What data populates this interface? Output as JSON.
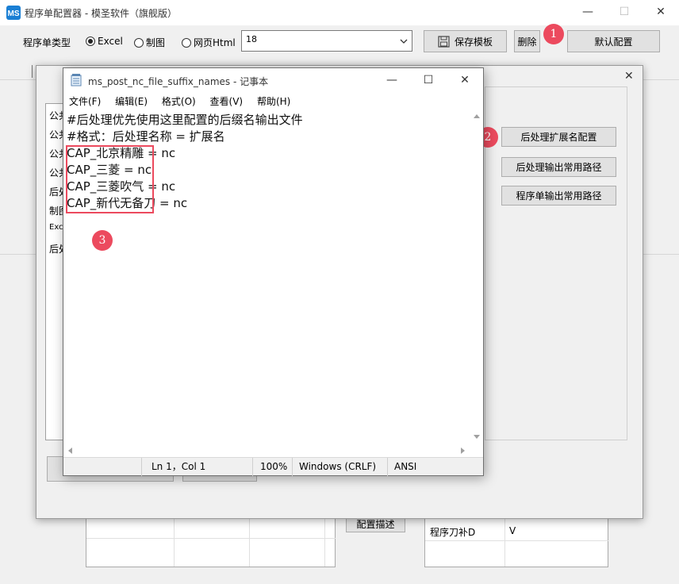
{
  "main_window": {
    "title": "程序单配置器 - 模圣软件（旗舰版）",
    "type_label": "程序单类型",
    "radio_excel": "Excel",
    "radio_drawing": "制图",
    "radio_html": "网页Html",
    "template_value": "18",
    "save_template": "保存模板",
    "delete": "删除",
    "default_config": "默认配置",
    "config_desc": "配置描述",
    "grid_cell_label": "程序刀补D",
    "grid_cell_value": "V"
  },
  "dialog": {
    "list_items": [
      "公共",
      "公共",
      "公共",
      "公共",
      "后处",
      "制图",
      "Excel",
      "后处"
    ],
    "btn_postfix_config": "后处理扩展名配置",
    "btn_post_output_path": "后处理输出常用路径",
    "btn_program_output_path": "程序单输出常用路径"
  },
  "notepad": {
    "title": "ms_post_nc_file_suffix_names - 记事本",
    "menu": [
      "文件(F)",
      "编辑(E)",
      "格式(O)",
      "查看(V)",
      "帮助(H)"
    ],
    "lines": [
      "#后处理优先使用这里配置的后缀名输出文件",
      "#格式：后处理名称 = 扩展名",
      "CAP_北京精雕 = nc",
      "CAP_三菱 = nc",
      "CAP_三菱吹气 = nc",
      "CAP_新代无备刀 = nc"
    ],
    "status": {
      "position": "Ln 1，Col 1",
      "zoom": "100%",
      "line_ending": "Windows (CRLF)",
      "encoding": "ANSI"
    }
  },
  "annotations": {
    "badge1": "1",
    "badge2": "2",
    "badge3": "3",
    "color": "#ec4a5e"
  }
}
